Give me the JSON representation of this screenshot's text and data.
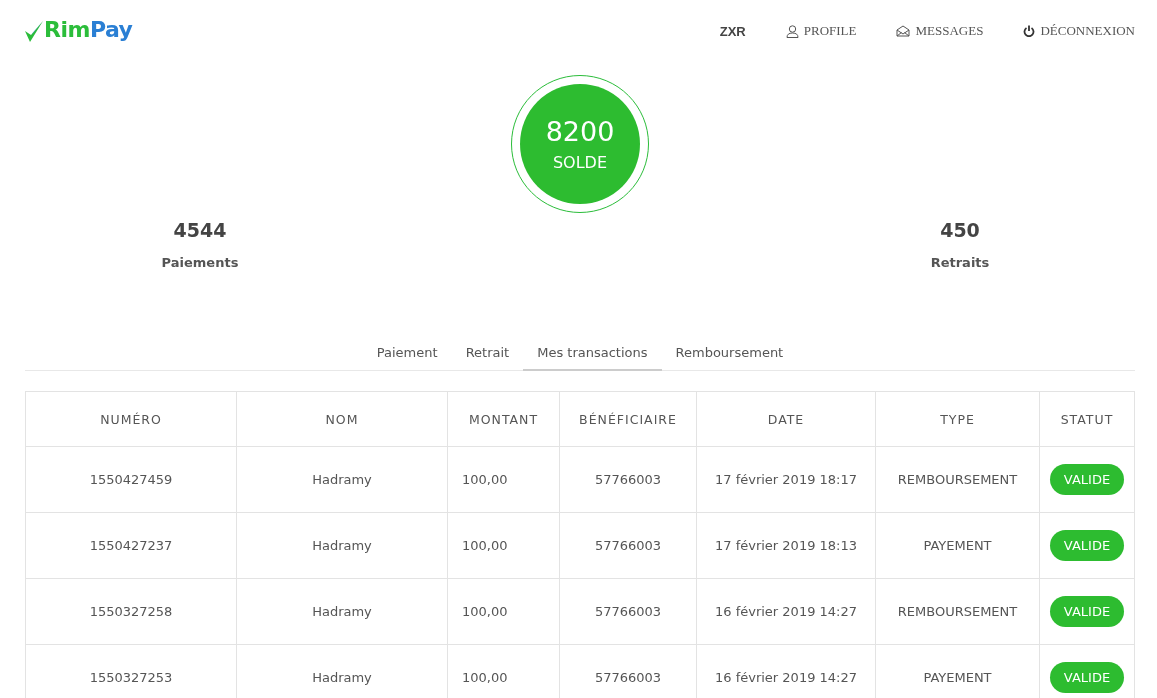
{
  "logo": {
    "part_1": "Rim",
    "part_2": "Pay"
  },
  "nav": [
    {
      "label": "ZXR",
      "kind": "account"
    },
    {
      "label": "PROFILE",
      "kind": "profile"
    },
    {
      "label": "MESSAGES",
      "kind": "messages"
    },
    {
      "label": "DÉCONNEXION",
      "kind": "logout"
    }
  ],
  "balance": {
    "value": "8200",
    "label": "SOLDE"
  },
  "stats": [
    {
      "value": "4544",
      "label": "Paiements"
    },
    {
      "value": "450",
      "label": "Retraits"
    }
  ],
  "tabs": [
    {
      "label": "Paiement",
      "selected": false
    },
    {
      "label": "Retrait",
      "selected": false
    },
    {
      "label": "Mes transactions",
      "selected": true
    },
    {
      "label": "Remboursement",
      "selected": false
    }
  ],
  "table": {
    "columns": [
      "NUMÉRO",
      "NOM",
      "MONTANT",
      "BÉNÉFICIAIRE",
      "DATE",
      "TYPE",
      "STATUT"
    ],
    "rows": [
      {
        "numero": "1550427459",
        "nom": "Hadramy",
        "montant": "100,00",
        "beneficiaire": "57766003",
        "date": "17 février 2019 18:17",
        "type": "REMBOURSEMENT",
        "statut": "VALIDE"
      },
      {
        "numero": "1550427237",
        "nom": "Hadramy",
        "montant": "100,00",
        "beneficiaire": "57766003",
        "date": "17 février 2019 18:13",
        "type": "PAYEMENT",
        "statut": "VALIDE"
      },
      {
        "numero": "1550327258",
        "nom": "Hadramy",
        "montant": "100,00",
        "beneficiaire": "57766003",
        "date": "16 février 2019 14:27",
        "type": "REMBOURSEMENT",
        "statut": "VALIDE"
      },
      {
        "numero": "1550327253",
        "nom": "Hadramy",
        "montant": "100,00",
        "beneficiaire": "57766003",
        "date": "16 février 2019 14:27",
        "type": "PAYEMENT",
        "statut": "VALIDE"
      }
    ]
  }
}
